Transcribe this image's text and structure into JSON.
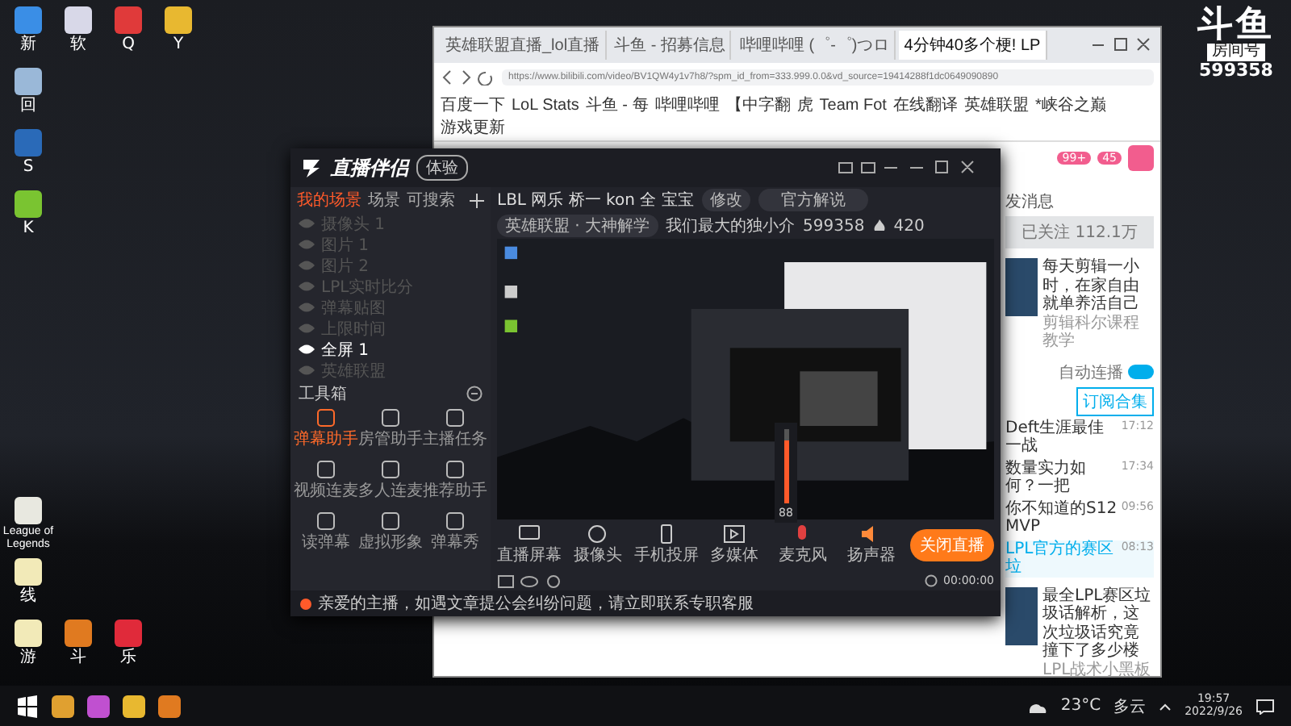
{
  "desktop_icons": [
    {
      "label": "新",
      "color": "#3a8ee6"
    },
    {
      "label": "软",
      "color": "#d8d8e8"
    },
    {
      "label": "Q",
      "color": "#e03a3a"
    },
    {
      "label": "Y",
      "color": "#e8b830"
    },
    {
      "label": "回",
      "color": "#9ab8d8"
    },
    {
      "label": "S",
      "color": "#2a6ab8"
    },
    {
      "label": "K",
      "color": "#7ac431"
    },
    {
      "label": "League of Legends",
      "color": "#e8e8e0"
    },
    {
      "label": "线",
      "color": "#f2eab8"
    },
    {
      "label": "游",
      "color": "#f2eab8"
    },
    {
      "label": "斗",
      "color": "#e07a20"
    },
    {
      "label": "乐",
      "color": "#e02a3a"
    }
  ],
  "browser": {
    "tabs": [
      {
        "title": "英雄联盟直播_lol直播",
        "selected": false
      },
      {
        "title": "斗鱼 - 招募信息",
        "selected": false
      },
      {
        "title": "哔哩哔哩 (゜-゜)つロ",
        "selected": false
      },
      {
        "title": "4分钟40多个梗! LP",
        "selected": true
      }
    ],
    "address": "https://www.bilibili.com/video/BV1QW4y1v7h8/?spm_id_from=333.999.0.0&vd_source=19414288f1dc0649090890",
    "bookmarks": [
      "百度一下",
      "LoL Stats",
      "斗鱼 - 每",
      "哔哩哔哩",
      "【中字翻",
      "虎",
      "Team Fot",
      "在线翻译",
      "英雄联盟",
      "*峡谷之巅",
      "游戏更新"
    ],
    "badges": [
      "99+",
      "45"
    ],
    "side": {
      "message": "发消息",
      "follow": "已关注 112.1万",
      "ad_title": "每天剪辑一小时，在家自由就单养活自己",
      "ad_source": "剪辑科尔课程教学",
      "autoplay_label": "自动连播",
      "autoplay": true,
      "subscribe": "订阅合集",
      "playlist": [
        {
          "title": "Deft生涯最佳一战",
          "time": "17:12",
          "selected": false
        },
        {
          "title": "数量实力如何？一把",
          "time": "17:34",
          "selected": false
        },
        {
          "title": "你不知道的S12MVP",
          "time": "09:56",
          "selected": false
        },
        {
          "title": "LPL官方的赛区垃",
          "time": "08:13",
          "selected": true
        }
      ],
      "rec_title": "最全LPL赛区垃圾话解析，这次垃圾话究竟撞下了多少楼",
      "rec_author": "LPL战术小黑板"
    }
  },
  "streamer": {
    "app_name": "直播伴侣",
    "beta": "体验",
    "scene_tabs": [
      {
        "label": "我的场景",
        "selected": true
      },
      {
        "label": "场景",
        "selected": false
      },
      {
        "label": "可搜索",
        "selected": false
      }
    ],
    "sources": [
      {
        "name": "摄像头 1",
        "visible": false
      },
      {
        "name": "图片 1",
        "visible": false
      },
      {
        "name": "图片 2",
        "visible": false
      },
      {
        "name": "LPL实时比分",
        "visible": false
      },
      {
        "name": "弹幕贴图",
        "visible": false
      },
      {
        "name": "上限时间",
        "visible": false
      },
      {
        "name": "全屏 1",
        "visible": true
      },
      {
        "name": "英雄联盟",
        "visible": false
      }
    ],
    "toolbox_title": "工具箱",
    "tools": [
      {
        "label": "弹幕助手",
        "active": true
      },
      {
        "label": "房管助手",
        "active": false
      },
      {
        "label": "主播任务",
        "active": false
      },
      {
        "label": "视频连麦",
        "active": false
      },
      {
        "label": "多人连麦",
        "active": false
      },
      {
        "label": "推荐助手",
        "active": false
      },
      {
        "label": "读弹幕",
        "active": false
      },
      {
        "label": "虚拟形象",
        "active": false
      },
      {
        "label": "弹幕秀",
        "active": false
      }
    ],
    "title": "LBL 网乐 桥一 kon 全 宝宝",
    "title_tag": "修改",
    "announce": "官方解说",
    "category": "英雄联盟 · 大神解学",
    "nickname": "我们最大的独小介",
    "room": "599358",
    "hot": "420",
    "controls": [
      {
        "label": "直播屏幕",
        "kind": "screen"
      },
      {
        "label": "摄像头",
        "kind": "camera"
      },
      {
        "label": "手机投屏",
        "kind": "phone"
      },
      {
        "label": "多媒体",
        "kind": "media"
      },
      {
        "label": "麦克风",
        "kind": "mic"
      },
      {
        "label": "扬声器",
        "kind": "speaker"
      }
    ],
    "mic_volume": {
      "level": 0.85,
      "reading": "88"
    },
    "live_button": "关闭直播",
    "timer": "00:00:00",
    "notice": "亲爱的主播，如遇文章提公会纠纷问题，请立即联系专职客服"
  },
  "watermark_logo": {
    "brand": "斗鱼",
    "room_label": "房间号",
    "room": "599358"
  },
  "taskbar": {
    "temperature": "23°C",
    "weather": "多云",
    "time": "19:57",
    "date": "2022/9/26"
  }
}
